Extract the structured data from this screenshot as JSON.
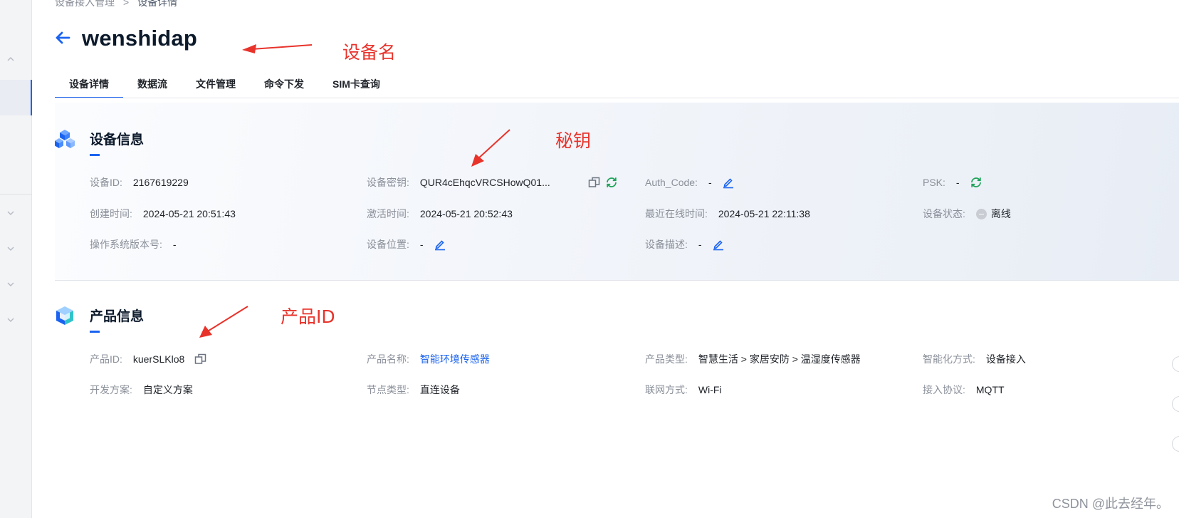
{
  "breadcrumb": {
    "parent": "设备接入管理",
    "separator": ">",
    "current": "设备详情"
  },
  "header": {
    "back_label": "←",
    "device_name": "wenshidap"
  },
  "tabs": [
    {
      "label": "设备详情",
      "active": true
    },
    {
      "label": "数据流"
    },
    {
      "label": "文件管理"
    },
    {
      "label": "命令下发"
    },
    {
      "label": "SIM卡查询"
    }
  ],
  "device_info": {
    "title": "设备信息",
    "device_id": {
      "label": "设备ID:",
      "value": "2167619229"
    },
    "device_secret": {
      "label": "设备密钥:",
      "value": "QUR4cEhqcVRCSHowQ01..."
    },
    "auth_code": {
      "label": "Auth_Code:",
      "value": "-"
    },
    "psk": {
      "label": "PSK:",
      "value": "-"
    },
    "created_time": {
      "label": "创建时间:",
      "value": "2024-05-21 20:51:43"
    },
    "activated_time": {
      "label": "激活时间:",
      "value": "2024-05-21 20:52:43"
    },
    "last_online_time": {
      "label": "最近在线时间:",
      "value": "2024-05-21 22:11:38"
    },
    "device_status": {
      "label": "设备状态:",
      "value": "离线"
    },
    "os_version": {
      "label": "操作系统版本号:",
      "value": "-"
    },
    "location": {
      "label": "设备位置:",
      "value": "-"
    },
    "description": {
      "label": "设备描述:",
      "value": "-"
    }
  },
  "product_info": {
    "title": "产品信息",
    "product_id": {
      "label": "产品ID:",
      "value": "kuerSLKlo8"
    },
    "product_name": {
      "label": "产品名称:",
      "value": "智能环境传感器"
    },
    "product_type": {
      "label": "产品类型:",
      "value": "智慧生活 > 家居安防 > 温湿度传感器"
    },
    "smart_mode": {
      "label": "智能化方式:",
      "value": "设备接入"
    },
    "dev_plan": {
      "label": "开发方案:",
      "value": "自定义方案"
    },
    "node_type": {
      "label": "节点类型:",
      "value": "直连设备"
    },
    "network": {
      "label": "联网方式:",
      "value": "Wi-Fi"
    },
    "protocol": {
      "label": "接入协议:",
      "value": "MQTT"
    }
  },
  "annotations": {
    "device_name": "设备名",
    "secret": "秘钥",
    "product_id": "产品ID"
  },
  "watermark": "CSDN @此去经年。",
  "icons": {
    "back": "arrow-left-icon",
    "copy": "copy-icon",
    "refresh": "refresh-icon",
    "edit": "edit-icon",
    "status": "offline-status-icon",
    "device_section": "cubes-icon",
    "product_section": "cube-icon"
  },
  "colors": {
    "accent": "#1a63f0",
    "refresh": "#1ea35a",
    "annotation": "#e8332b"
  }
}
